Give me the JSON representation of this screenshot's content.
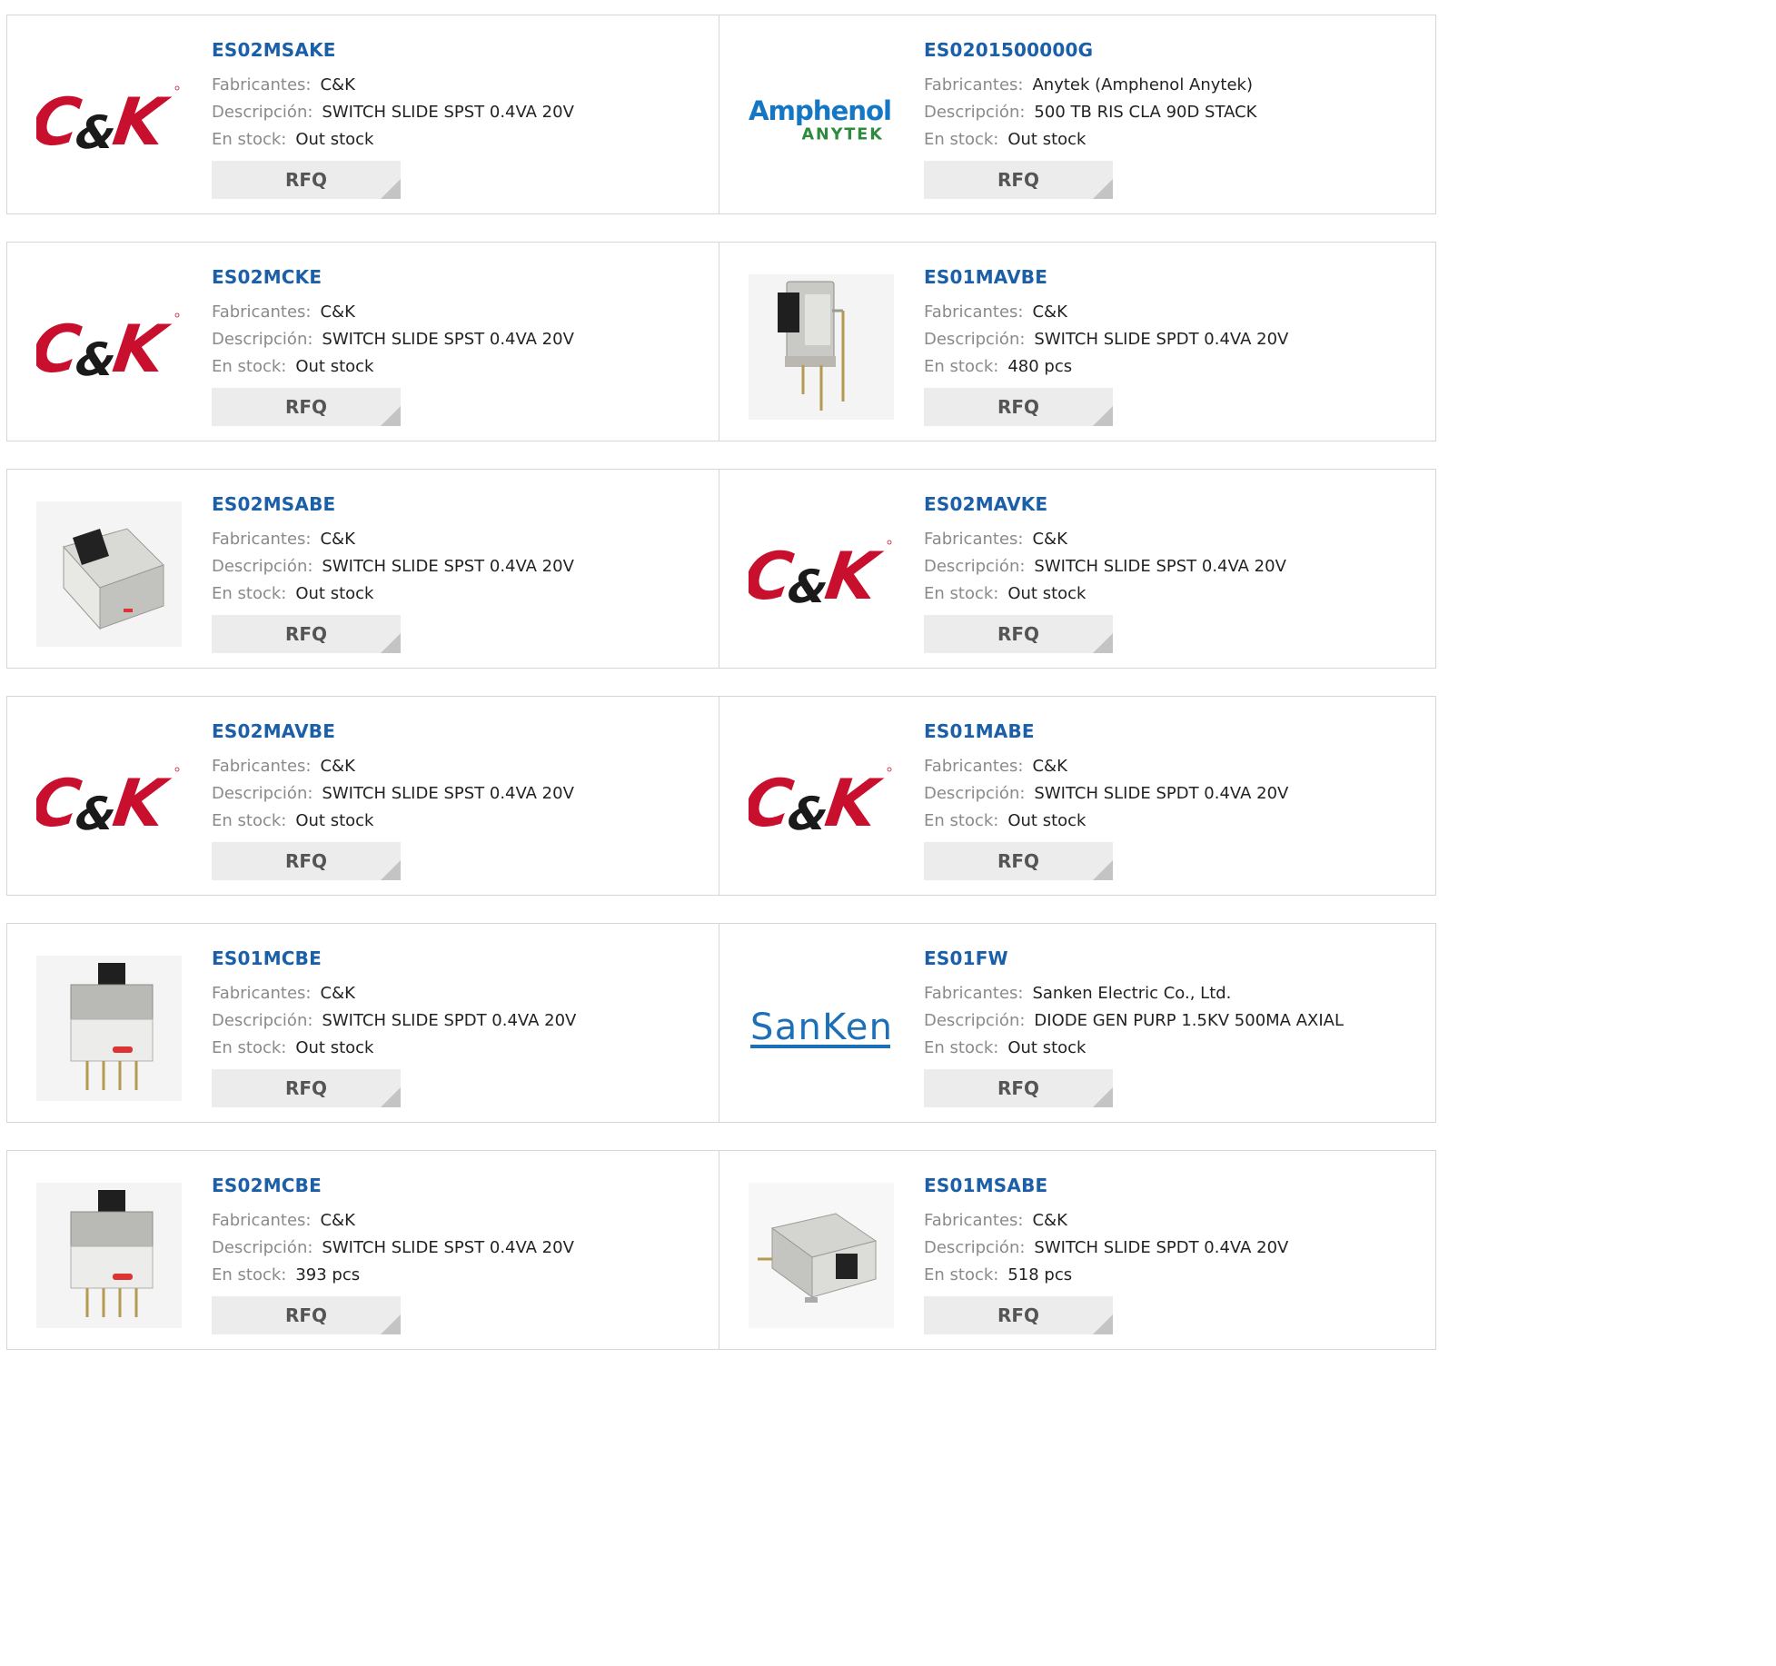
{
  "labels": {
    "manufacturer": "Fabricantes:",
    "description": "Descripción:",
    "stock": "En stock:",
    "rfq": "RFQ"
  },
  "products": [
    {
      "part": "ES02MSAKE",
      "manufacturer": "C&K",
      "description": "SWITCH SLIDE SPST 0.4VA 20V",
      "stock": "Out stock",
      "image": "ck-logo"
    },
    {
      "part": "ES0201500000G",
      "manufacturer": "Anytek (Amphenol Anytek)",
      "description": "500 TB RIS CLA 90D STACK",
      "stock": "Out stock",
      "image": "amphenol-anytek-logo",
      "logo_text": [
        "Amphenol",
        "ANYTEK"
      ]
    },
    {
      "part": "ES02MCKE",
      "manufacturer": "C&K",
      "description": "SWITCH SLIDE SPST 0.4VA 20V",
      "stock": "Out stock",
      "image": "ck-logo"
    },
    {
      "part": "ES01MAVBE",
      "manufacturer": "C&K",
      "description": "SWITCH SLIDE SPDT 0.4VA 20V",
      "stock": "480 pcs",
      "image": "slide-switch-vertical-photo"
    },
    {
      "part": "ES02MSABE",
      "manufacturer": "C&K",
      "description": "SWITCH SLIDE SPST 0.4VA 20V",
      "stock": "Out stock",
      "image": "slide-switch-smd-photo"
    },
    {
      "part": "ES02MAVKE",
      "manufacturer": "C&K",
      "description": "SWITCH SLIDE SPST 0.4VA 20V",
      "stock": "Out stock",
      "image": "ck-logo"
    },
    {
      "part": "ES02MAVBE",
      "manufacturer": "C&K",
      "description": "SWITCH SLIDE SPST 0.4VA 20V",
      "stock": "Out stock",
      "image": "ck-logo"
    },
    {
      "part": "ES01MABE",
      "manufacturer": "C&K",
      "description": "SWITCH SLIDE SPDT 0.4VA 20V",
      "stock": "Out stock",
      "image": "ck-logo"
    },
    {
      "part": "ES01MCBE",
      "manufacturer": "C&K",
      "description": "SWITCH SLIDE SPDT 0.4VA 20V",
      "stock": "Out stock",
      "image": "slide-switch-tht-photo"
    },
    {
      "part": "ES01FW",
      "manufacturer": "Sanken Electric Co., Ltd.",
      "description": "DIODE GEN PURP 1.5KV 500MA AXIAL",
      "stock": "Out stock",
      "image": "sanken-logo",
      "logo_text": "SanKen"
    },
    {
      "part": "ES02MCBE",
      "manufacturer": "C&K",
      "description": "SWITCH SLIDE SPST 0.4VA 20V",
      "stock": "393 pcs",
      "image": "slide-switch-tht-photo"
    },
    {
      "part": "ES01MSABE",
      "manufacturer": "C&K",
      "description": "SWITCH SLIDE SPDT 0.4VA 20V",
      "stock": "518 pcs",
      "image": "slide-switch-side-photo"
    }
  ],
  "colors": {
    "part_link": "#1a5fa8",
    "label": "#8a8a8a",
    "ck_red": "#c8102e",
    "amphenol_blue": "#1577c4",
    "anytek_green": "#2e8b3e",
    "sanken_blue": "#1d6fb8",
    "rfq_bg": "#ececec"
  }
}
